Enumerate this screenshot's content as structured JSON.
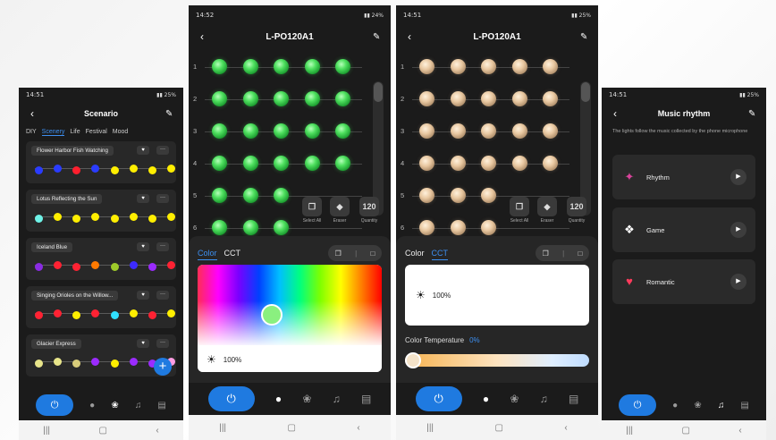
{
  "phone_scenario": {
    "status": {
      "time": "14:51",
      "right": "▮▮ 25%"
    },
    "title": "Scenario",
    "tabs": [
      "DIY",
      "Scenery",
      "Life",
      "Festival",
      "Mood"
    ],
    "active_tab": "Scenery",
    "scenes": [
      {
        "name": "Flower Harbor Fish Watching",
        "colors": [
          "#2a3cff",
          "#2a3cff",
          "#ff1f2e",
          "#2a3cff",
          "#ffee00",
          "#ffee00",
          "#ffee00",
          "#ffee00"
        ]
      },
      {
        "name": "Lotus Reflecting the Sun",
        "colors": [
          "#6ff3e8",
          "#ffee00",
          "#ffee00",
          "#ffee00",
          "#ffee00",
          "#ffee00",
          "#ffee00",
          "#ffee00"
        ]
      },
      {
        "name": "Iceland Blue",
        "colors": [
          "#8a2be2",
          "#ff2233",
          "#ff2233",
          "#ff7a00",
          "#9ecb2a",
          "#3d2bff",
          "#9b2bff",
          "#ff2233"
        ]
      },
      {
        "name": "Singing Orioles on the Willow...",
        "colors": [
          "#ff2233",
          "#ff2233",
          "#ffee00",
          "#ff2233",
          "#30e0ff",
          "#ffee00",
          "#ff2233",
          "#ffee00"
        ]
      },
      {
        "name": "Glacier Express",
        "colors": [
          "#e8e58a",
          "#e8e58a",
          "#d8cc7a",
          "#9b2bff",
          "#ffee00",
          "#9b2bff",
          "#9b2bff",
          "#ff9de2"
        ]
      }
    ],
    "fab": "+"
  },
  "phone_color": {
    "status": {
      "time": "14:52",
      "right": "▮▮ 24%"
    },
    "title": "L-PO120A1",
    "row_numbers": [
      "1",
      "2",
      "3",
      "4",
      "5",
      "6"
    ],
    "tools": {
      "select_all": "Select All",
      "eraser": "Eraser",
      "quantity_label": "Quantity",
      "quantity": "120"
    },
    "tabs": {
      "color": "Color",
      "cct": "CCT",
      "active": "Color"
    },
    "brightness": "100%"
  },
  "phone_cct": {
    "status": {
      "time": "14:51",
      "right": "▮▮ 25%"
    },
    "title": "L-PO120A1",
    "row_numbers": [
      "1",
      "2",
      "3",
      "4",
      "5",
      "6"
    ],
    "tools": {
      "select_all": "Select All",
      "eraser": "Eraser",
      "quantity_label": "Quantity",
      "quantity": "120"
    },
    "tabs": {
      "color": "Color",
      "cct": "CCT",
      "active": "CCT"
    },
    "brightness": "100%",
    "color_temp_label": "Color Temperature",
    "color_temp_value": "0%",
    "color_temp_level": 0
  },
  "phone_music": {
    "status": {
      "time": "14:51",
      "right": "▮▮ 25%"
    },
    "title": "Music rhythm",
    "description": "The lights follow the music collected by the phone microphone",
    "modes": [
      {
        "name": "Rhythm",
        "icon": "rhythm-icon"
      },
      {
        "name": "Game",
        "icon": "gamepad-icon"
      },
      {
        "name": "Romantic",
        "icon": "hearts-icon"
      }
    ]
  }
}
